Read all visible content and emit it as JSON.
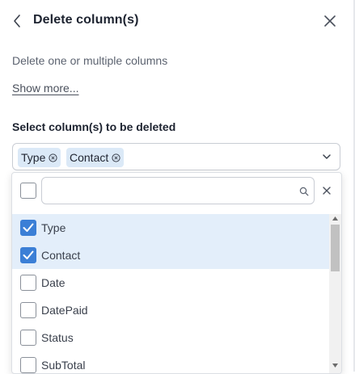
{
  "header": {
    "title": "Delete column(s)",
    "back_icon": "chevron-left-icon",
    "close_icon": "close-icon"
  },
  "description": "Delete one or multiple columns",
  "show_more_label": "Show more...",
  "field": {
    "label": "Select column(s) to be deleted",
    "selected_chips": [
      "Type",
      "Contact"
    ],
    "chip_color": "#dbe9f7",
    "dropdown_icon": "chevron-down-icon"
  },
  "dropdown": {
    "search_value": "",
    "search_icon": "search-icon",
    "clear_icon": "clear-icon",
    "options": [
      {
        "label": "Type",
        "checked": true
      },
      {
        "label": "Contact",
        "checked": true
      },
      {
        "label": "Date",
        "checked": false
      },
      {
        "label": "DatePaid",
        "checked": false
      },
      {
        "label": "Status",
        "checked": false
      },
      {
        "label": "SubTotal",
        "checked": false
      }
    ],
    "selected_row_color": "#e3eefa",
    "checkbox_color": "#3b7fd6"
  }
}
